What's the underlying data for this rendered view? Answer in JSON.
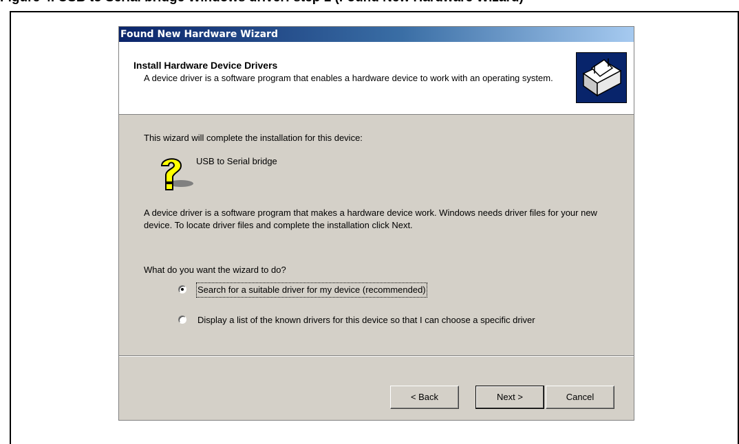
{
  "document": {
    "heading": "Figure 4. USB to Serial bridge Windows driver: step 1 (Found New Hardware Wizard)"
  },
  "window": {
    "title": "Found New Hardware Wizard"
  },
  "header": {
    "title": "Install Hardware Device Drivers",
    "subtitle": "A device driver is a software program that enables a hardware device to work with an operating system."
  },
  "body": {
    "intro": "This wizard will complete the installation for this device:",
    "device_name": "USB to Serial bridge",
    "explanation": "A device driver is a software program that makes a hardware device work. Windows needs driver files for your new device. To locate driver files and complete the installation click Next.",
    "question": "What do you want the wizard to do?",
    "options": [
      {
        "label": "Search for a suitable driver for my device (recommended)",
        "selected": true
      },
      {
        "label": "Display a list of the known drivers for this device so that I can choose a specific driver",
        "selected": false
      }
    ]
  },
  "buttons": {
    "back": "< Back",
    "next": "Next >",
    "cancel": "Cancel"
  },
  "icons": {
    "device": "question-mark-device-icon",
    "logo": "hardware-wizard-logo-icon"
  }
}
